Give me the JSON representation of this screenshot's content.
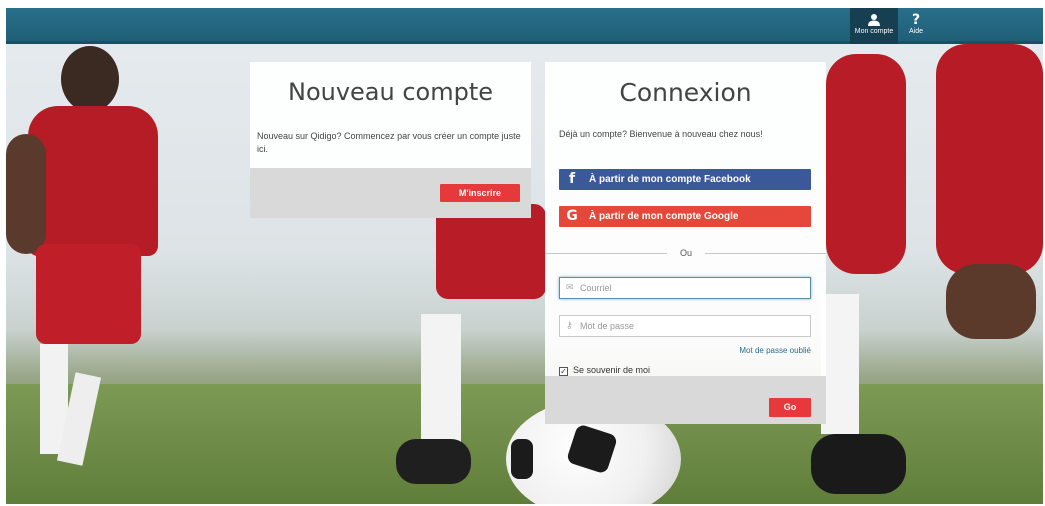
{
  "topbar": {
    "account_label": "Mon compte",
    "help_label": "Aide",
    "help_symbol": "?",
    "bar_color": "#296f89"
  },
  "signup_panel": {
    "title": "Nouveau compte",
    "description": "Nouveau sur Qidigo? Commencez par vous créer un compte juste ici.",
    "signup_button": "M'inscrire"
  },
  "login_panel": {
    "title": "Connexion",
    "description": "Déjà un compte? Bienvenue à nouveau chez nous!",
    "facebook_button": "À partir de mon compte Facebook",
    "google_button": "À partir de mon compte Google",
    "divider_text": "Ou",
    "email_placeholder": "Courriel",
    "password_placeholder": "Mot de passe",
    "forgot_password": "Mot de passe oublié",
    "remember_me": "Se souvenir de moi",
    "remember_checked": true,
    "go_button": "Go"
  },
  "icons": {
    "facebook": "facebook-icon",
    "google": "google-icon",
    "email": "envelope-icon",
    "password": "key-icon",
    "account": "user-icon",
    "help": "question-icon"
  },
  "colors": {
    "primary_red": "#e6393b",
    "facebook": "#3b5998",
    "google": "#e5483a"
  }
}
